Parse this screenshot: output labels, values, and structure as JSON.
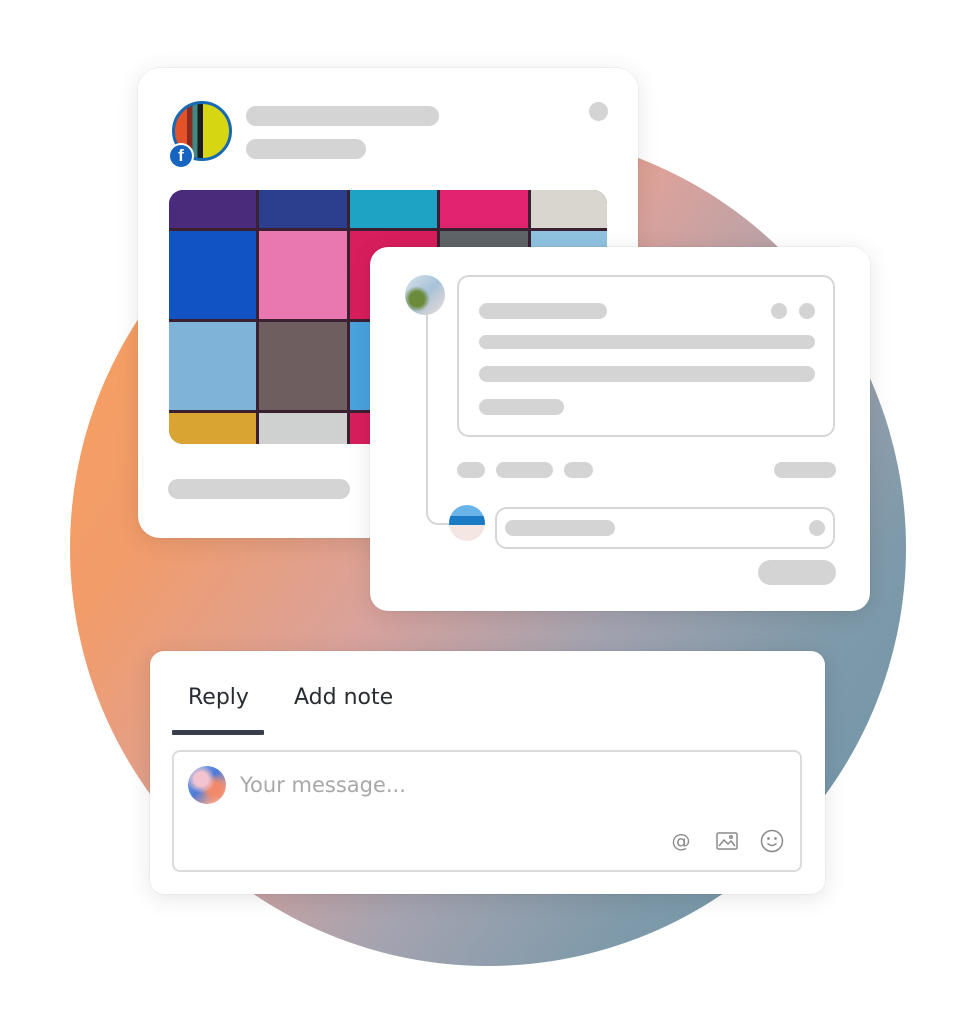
{
  "illustration": {
    "background_gradient": [
      "#f9a05c",
      "#d9a29c",
      "#6b93a8"
    ]
  },
  "post_card": {
    "platform_badge": {
      "icon": "facebook-icon",
      "glyph": "f",
      "color": "#1565c0"
    },
    "avatar_stripe_colors": [
      "#e4522a",
      "#8a2b22",
      "#3f8a84",
      "#1c1c1c",
      "#d6d612"
    ],
    "image_tiles": [
      "#4a2a7a",
      "#2c3f8f",
      "#1fa3c4",
      "#e2236f",
      "#d8d6cf",
      "#1253c4",
      "#e978b0",
      "#d81e5c",
      "#5e6468",
      "#8fc3e0",
      "#7fb4d8",
      "#6e5e60",
      "#4aa3de",
      "#d81e5c",
      "#8fc3e0",
      "#d9a432",
      "#cfd0d0",
      "#d81e5c",
      "#d81e5c",
      "#d81e5c"
    ]
  },
  "comment_card": {},
  "reply_card": {
    "tabs": [
      {
        "label": "Reply",
        "active": true
      },
      {
        "label": "Add note",
        "active": false
      }
    ],
    "message_placeholder": "Your message...",
    "message_value": "",
    "toolbar": {
      "mention_glyph": "@",
      "mention_icon": "at-mention-icon",
      "image_icon": "image-icon",
      "emoji_icon": "emoji-icon"
    }
  }
}
